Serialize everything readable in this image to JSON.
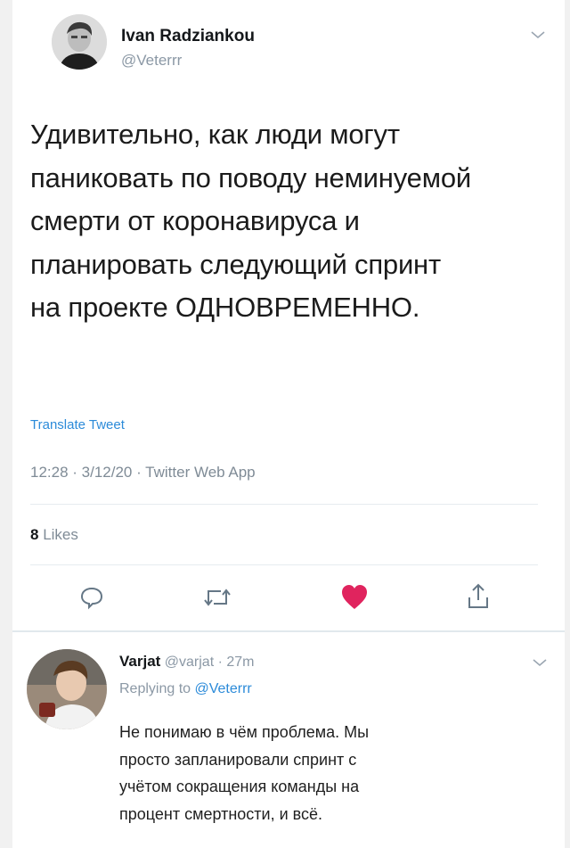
{
  "tweet": {
    "author_name": "Ivan Radziankou",
    "author_handle": "@Veterrr",
    "text": "Удивительно, как люди могут паниковать по поводу неминуемой смерти от коронавируса и планировать следующий спринт на проекте ОДНОВРЕМЕННО.",
    "lines": [
      "Удивительно, как люди могут",
      "паниковать по поводу неминуемой",
      "смерти от коронавируса и",
      "планировать следующий спринт",
      "на проекте ОДНОВРЕМЕННО."
    ],
    "translate_label": "Translate Tweet",
    "timestamp": "12:28 · 3/12/20 · Twitter Web App",
    "likes_count": "8",
    "likes_label": "Likes",
    "liked": true,
    "icons": [
      "reply-icon",
      "retweet-icon",
      "heart-icon",
      "share-icon"
    ]
  },
  "reply": {
    "author_name": "Varjat",
    "author_handle": "@varjat",
    "time": "· 27m",
    "replying_label": "Replying to",
    "replying_handle": "@Veterrr",
    "lines": [
      "Не понимаю в чём проблема. Мы",
      "просто запланировали спринт с",
      "учётом сокращения команды на",
      "процент смертности, и всё."
    ]
  },
  "colors": {
    "accent": "#1da1f2",
    "like": "#e0245e",
    "muted": "#8b98a5"
  }
}
